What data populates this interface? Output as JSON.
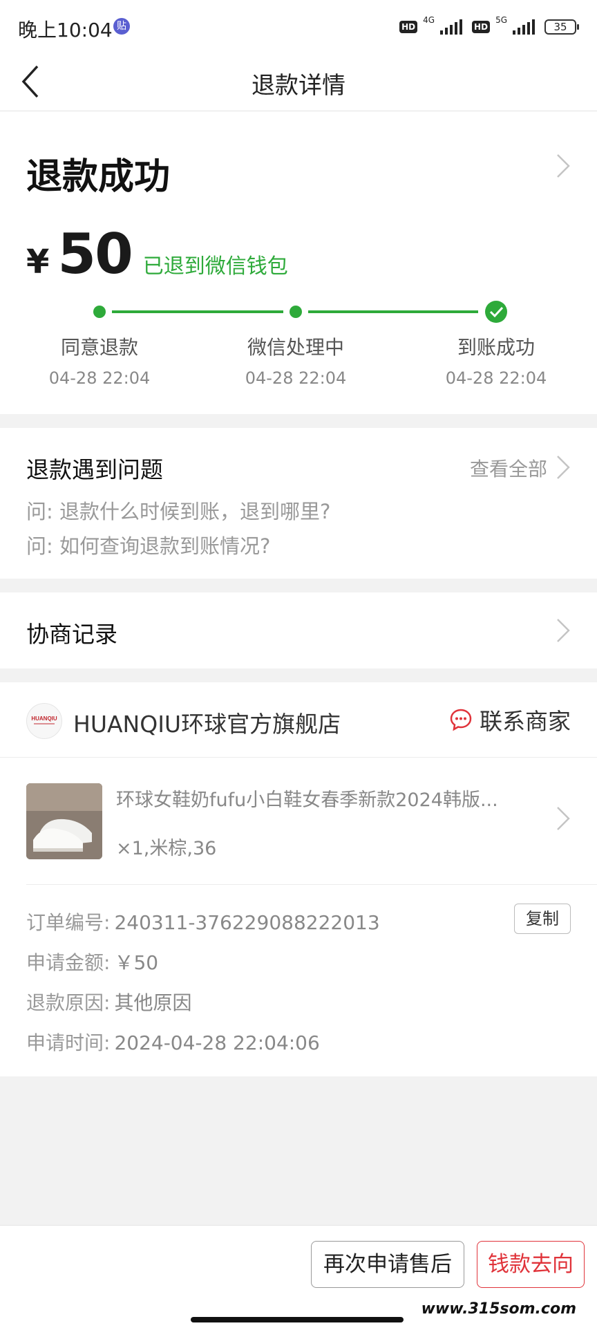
{
  "status_bar": {
    "time": "晚上10:04",
    "app_badge": "贴",
    "hd1": "HD",
    "net1": "4G",
    "hd2": "HD",
    "net2": "5G",
    "battery": "35"
  },
  "nav": {
    "title": "退款详情",
    "back_icon": "chevron-left-icon"
  },
  "refund": {
    "status_title": "退款成功",
    "currency": "¥",
    "amount": "50",
    "destination": "已退到微信钱包",
    "steps": [
      {
        "label": "同意退款",
        "time": "04-28 22:04"
      },
      {
        "label": "微信处理中",
        "time": "04-28 22:04"
      },
      {
        "label": "到账成功",
        "time": "04-28 22:04"
      }
    ],
    "progress_color": "#2eaa3a"
  },
  "faq": {
    "title": "退款遇到问题",
    "view_all": "查看全部",
    "questions": [
      "问: 退款什么时候到账，退到哪里?",
      "问: 如何查询退款到账情况?"
    ]
  },
  "negotiation": {
    "title": "协商记录"
  },
  "shop": {
    "logo_text": "HUANQIU",
    "name": "HUANQIU环球官方旗舰店",
    "contact_label": "联系商家",
    "contact_icon": "chat-bubble-icon",
    "contact_color": "#e0333a",
    "product": {
      "title": "环球女鞋奶fufu小白鞋女春季新款2024韩版...",
      "spec": "×1,米棕,36"
    }
  },
  "order": {
    "order_no_label": "订单编号:",
    "order_no": "240311-376229088222013",
    "copy_label": "复制",
    "amount_label": "申请金额:",
    "amount": "￥50",
    "reason_label": "退款原因:",
    "reason": "其他原因",
    "time_label": "申请时间:",
    "time": "2024-04-28 22:04:06"
  },
  "bottom": {
    "apply_again": "再次申请售后",
    "money_flow": "钱款去向",
    "watermark": "www.315som.com"
  }
}
